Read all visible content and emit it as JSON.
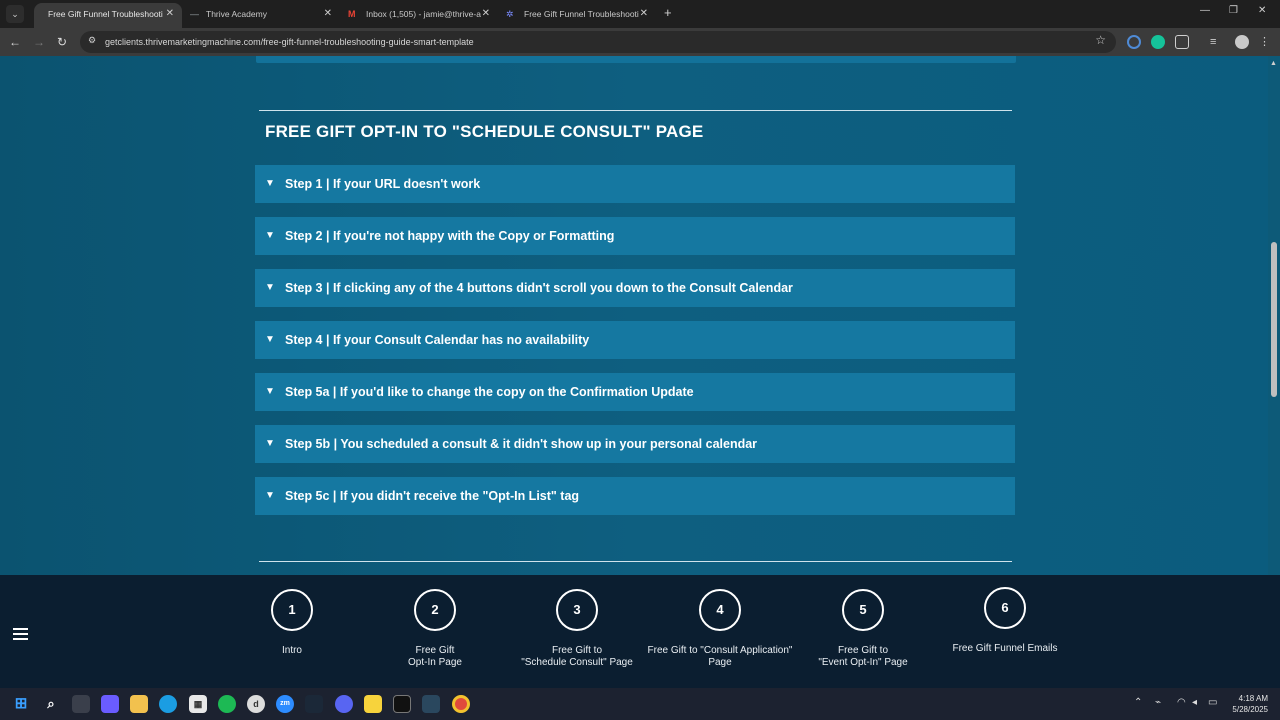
{
  "browser": {
    "tabs": [
      {
        "title": "Free Gift Funnel Troubleshooti",
        "active": true,
        "favicon": "none"
      },
      {
        "title": "Thrive Academy",
        "active": false,
        "favicon": "dash-icon"
      },
      {
        "title": "Inbox (1,505) - jamie@thrive-a",
        "active": false,
        "favicon": "gmail-icon"
      },
      {
        "title": "Free Gift Funnel Troubleshooti",
        "active": false,
        "favicon": "gear-icon"
      }
    ],
    "url": "getclients.thrivemarketingmachine.com/free-gift-funnel-troubleshooting-guide-smart-template"
  },
  "section": {
    "title": "FREE GIFT OPT-IN TO \"SCHEDULE CONSULT\" PAGE",
    "steps": [
      "Step 1 | If your URL doesn't work",
      "Step 2 | If you're not happy with the Copy or Formatting",
      "Step 3 | If clicking any of the 4 buttons didn't scroll you down to the Consult Calendar",
      "Step 4 | If your Consult Calendar has no availability",
      "Step 5a | If you'd like to change the copy on the Confirmation Update",
      "Step 5b | You scheduled a consult & it didn't show up in your personal calendar",
      "Step 5c | If you didn't receive the \"Opt-In List\" tag"
    ]
  },
  "stepnav": {
    "items": [
      {
        "number": "1",
        "label": "Intro"
      },
      {
        "number": "2",
        "label": "Free Gift\nOpt-In Page"
      },
      {
        "number": "3",
        "label": "Free Gift to\n\"Schedule Consult\" Page"
      },
      {
        "number": "4",
        "label": "Free Gift to \"Consult Application\"\nPage"
      },
      {
        "number": "5",
        "label": "Free Gift to\n\"Event Opt-In\" Page"
      },
      {
        "number": "6",
        "label": "Free Gift Funnel Emails"
      }
    ]
  },
  "taskbar": {
    "time": "4:18 AM",
    "date": "5/28/2025"
  },
  "colors": {
    "page_bg": "#0e5a78",
    "step_bg": "#1578a1",
    "nav_bg": "#0b1e30"
  }
}
